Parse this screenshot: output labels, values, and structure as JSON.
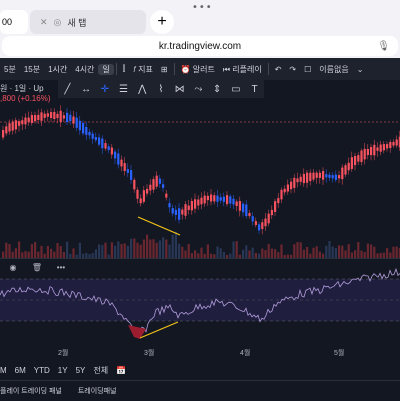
{
  "browser": {
    "tabs": [
      {
        "label": "00",
        "active": true
      },
      {
        "label": "새 탭",
        "active": false
      }
    ],
    "new_tab_icon": "+",
    "url": "kr.tradingview.com"
  },
  "toolbar": {
    "items": [
      "5분",
      "15분",
      "1시간",
      "4시간",
      "일",
      "지표",
      "알러트",
      "리플레이",
      "이름없음"
    ]
  },
  "legend": {
    "line1": "원 · 1일 · Up",
    "line2": ",800 (+0.16%)"
  },
  "time_axis": [
    "2월",
    "3월",
    "4월",
    "5월"
  ],
  "ranges": [
    "M",
    "6M",
    "YTD",
    "1Y",
    "5Y",
    "전체"
  ],
  "bottom_bar": [
    "플레이 트레이딩 패널",
    "트레이딩패널"
  ],
  "colors": {
    "up": "#f7525f",
    "down": "#2962ff",
    "divergence": "#f5c518",
    "rsi": "#b39ddb"
  }
}
